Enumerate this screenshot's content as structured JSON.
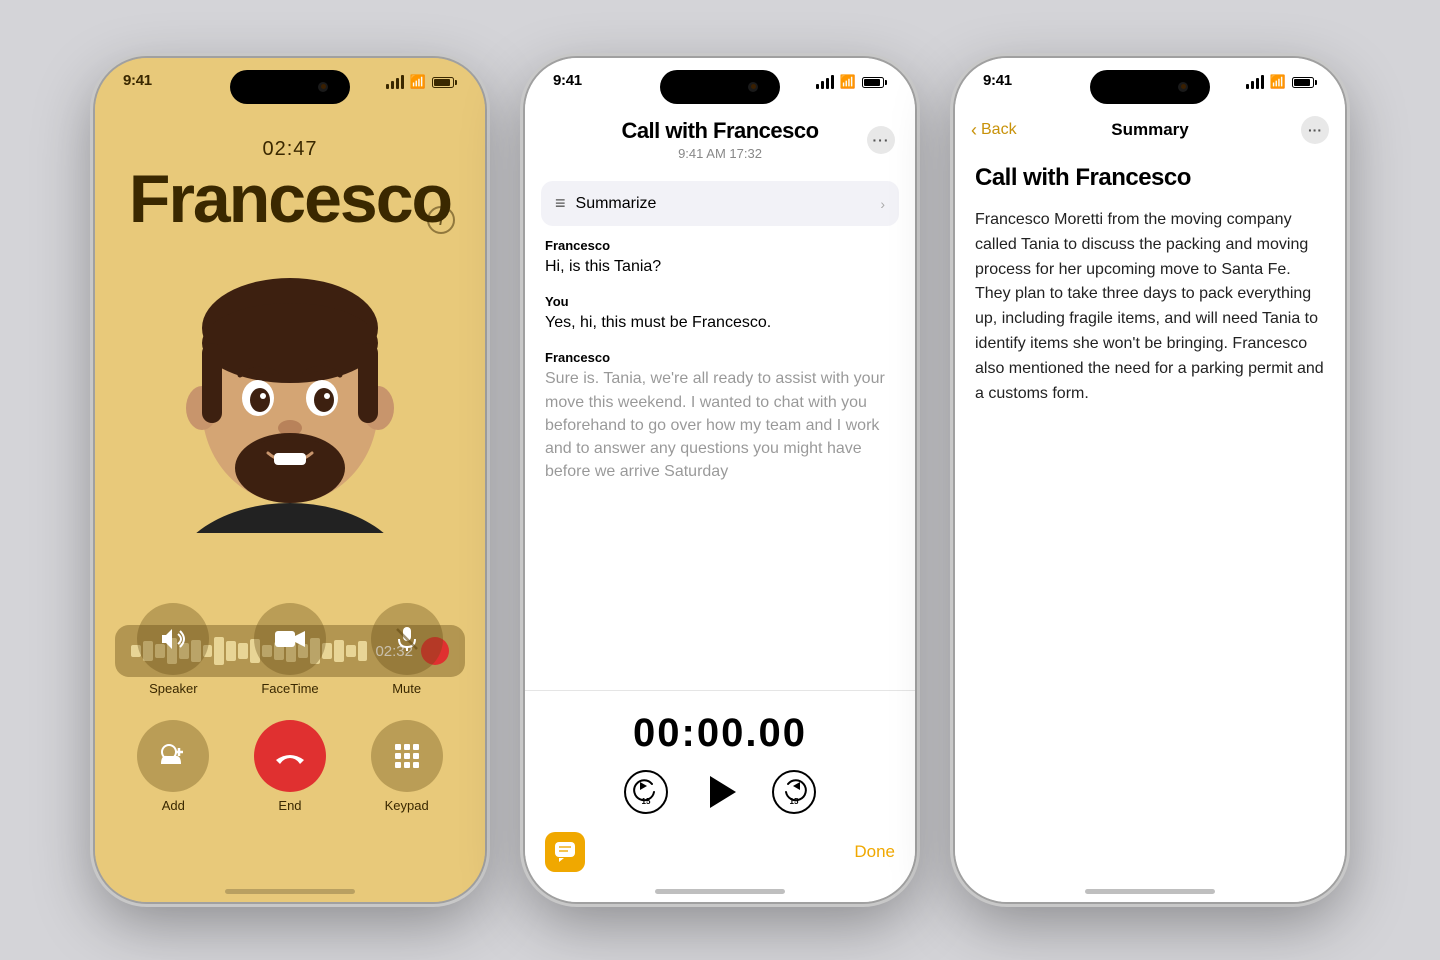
{
  "background": "#d4d4d8",
  "phone1": {
    "status_time": "9:41",
    "call_timer": "02:47",
    "call_name": "Francesco",
    "waveform_time": "02:32",
    "info_icon": "i",
    "controls": [
      {
        "icon": "🔊",
        "label": "Speaker"
      },
      {
        "icon": "📹",
        "label": "FaceTime"
      },
      {
        "icon": "🎤",
        "label": "Mute"
      }
    ],
    "controls_row2": [
      {
        "icon": "+",
        "label": "Add"
      },
      {
        "icon": "📞",
        "label": "End",
        "end": true
      },
      {
        "icon": "⌨",
        "label": "Keypad"
      }
    ]
  },
  "phone2": {
    "status_time": "9:41",
    "title": "Call with Francesco",
    "subtitle": "9:41 AM  17:32",
    "more_btn": "···",
    "summarize_label": "Summarize",
    "messages": [
      {
        "speaker": "Francesco",
        "text": "Hi, is this Tania?"
      },
      {
        "speaker": "You",
        "text": "Yes, hi, this must be Francesco."
      },
      {
        "speaker": "Francesco",
        "text": "Sure is. Tania, we're all ready to assist with your move this weekend. I wanted to chat with you beforehand to go over how my team and I work and to answer any questions you might have before we arrive Saturday",
        "faded": true
      }
    ],
    "playback_time": "00:00.00",
    "done_label": "Done",
    "chat_icon": "💬"
  },
  "phone3": {
    "status_time": "9:41",
    "back_label": "Back",
    "nav_title": "Summary",
    "more_btn": "···",
    "title": "Call with Francesco",
    "summary": "Francesco Moretti from the moving company called Tania to discuss the packing and moving process for her upcoming move to Santa Fe. They plan to take three days to pack everything up, including fragile items, and will need Tania to identify items she won't be bringing. Francesco also mentioned the need for a parking permit and a customs form."
  }
}
